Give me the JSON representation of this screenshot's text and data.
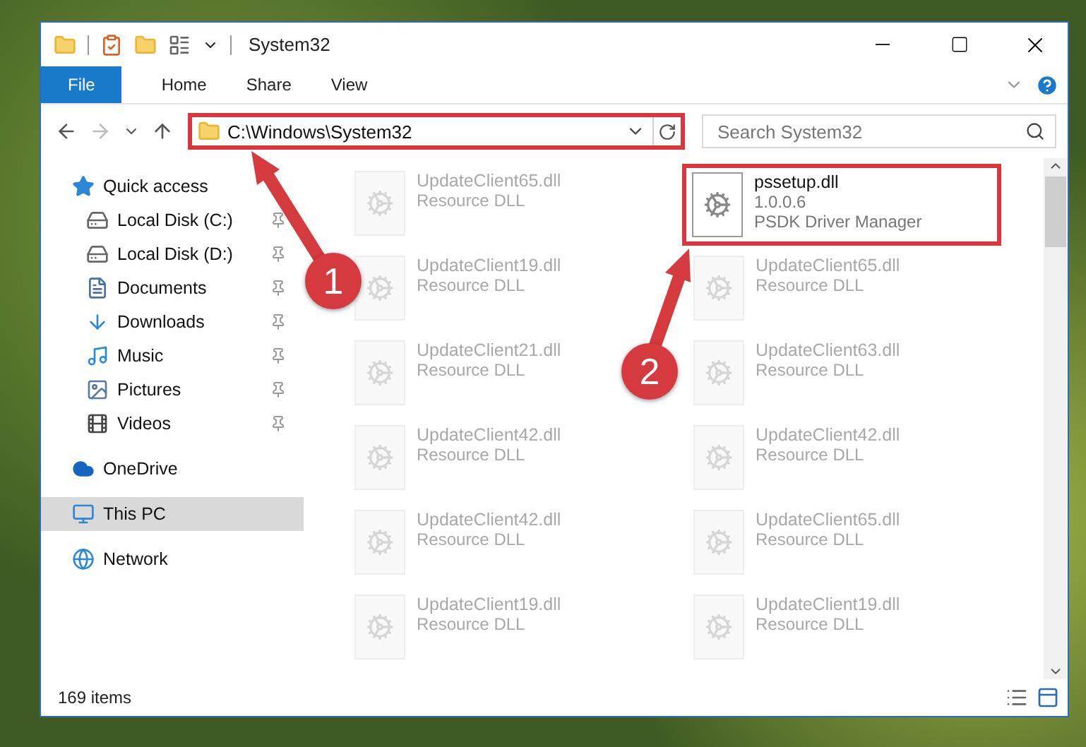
{
  "window": {
    "title": "System32"
  },
  "ribbon": {
    "tabs": [
      {
        "label": "File",
        "selected": true
      },
      {
        "label": "Home",
        "selected": false
      },
      {
        "label": "Share",
        "selected": false
      },
      {
        "label": "View",
        "selected": false
      }
    ]
  },
  "address": {
    "path": "C:\\Windows\\System32",
    "highlighted": true
  },
  "search": {
    "placeholder": "Search System32"
  },
  "sidebar": {
    "items": [
      {
        "label": "Quick access",
        "kind": "star",
        "selected": false,
        "children": [
          {
            "label": "Local Disk (C:)",
            "kind": "drive-c",
            "pinned": true,
            "selected": false
          },
          {
            "label": "Local Disk (D:)",
            "kind": "drive",
            "pinned": true,
            "selected": false
          },
          {
            "label": "Documents",
            "kind": "documents",
            "pinned": true,
            "selected": false
          },
          {
            "label": "Downloads",
            "kind": "downloads",
            "pinned": true,
            "selected": false
          },
          {
            "label": "Music",
            "kind": "music",
            "pinned": true,
            "selected": false
          },
          {
            "label": "Pictures",
            "kind": "pictures",
            "pinned": true,
            "selected": false
          },
          {
            "label": "Videos",
            "kind": "videos",
            "pinned": true,
            "selected": false
          }
        ]
      },
      {
        "label": "OneDrive",
        "kind": "cloud",
        "selected": false
      },
      {
        "label": "This PC",
        "kind": "pc",
        "selected": true
      },
      {
        "label": "Network",
        "kind": "network",
        "selected": false
      }
    ]
  },
  "files": [
    {
      "name": "UpdateClient65.dll",
      "detail": "Resource DLL",
      "faded": true,
      "highlighted": false
    },
    {
      "name": "pssetup.dll",
      "version": "1.0.0.6",
      "detail": "PSDK Driver Manager",
      "faded": false,
      "highlighted": true
    },
    {
      "name": "UpdateClient19.dll",
      "detail": "Resource DLL",
      "faded": true,
      "highlighted": false
    },
    {
      "name": "UpdateClient65.dll",
      "detail": "Resource DLL",
      "faded": true,
      "highlighted": false
    },
    {
      "name": "UpdateClient21.dll",
      "detail": "Resource DLL",
      "faded": true,
      "highlighted": false
    },
    {
      "name": "UpdateClient63.dll",
      "detail": "Resource DLL",
      "faded": true,
      "highlighted": false
    },
    {
      "name": "UpdateClient42.dll",
      "detail": "Resource DLL",
      "faded": true,
      "highlighted": false
    },
    {
      "name": "UpdateClient42.dll",
      "detail": "Resource DLL",
      "faded": true,
      "highlighted": false
    },
    {
      "name": "UpdateClient42.dll",
      "detail": "Resource DLL",
      "faded": true,
      "highlighted": false
    },
    {
      "name": "UpdateClient65.dll",
      "detail": "Resource DLL",
      "faded": true,
      "highlighted": false
    },
    {
      "name": "UpdateClient19.dll",
      "detail": "Resource DLL",
      "faded": true,
      "highlighted": false
    },
    {
      "name": "UpdateClient19.dll",
      "detail": "Resource DLL",
      "faded": true,
      "highlighted": false
    }
  ],
  "status_bar": {
    "count": "169 items"
  },
  "annotations": [
    {
      "label": "1"
    },
    {
      "label": "2"
    }
  ]
}
